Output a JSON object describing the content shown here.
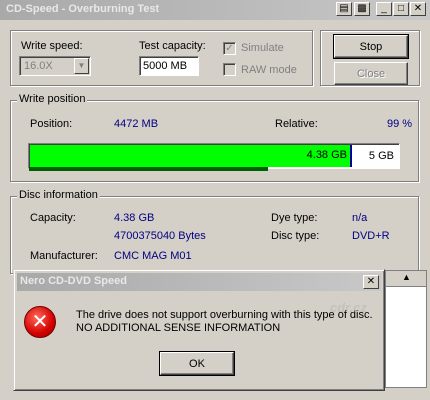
{
  "window": {
    "title": "CD-Speed - Overburning Test"
  },
  "settings": {
    "write_speed_label": "Write speed:",
    "write_speed_value": "16.0X",
    "test_capacity_label": "Test capacity:",
    "test_capacity_value": "5000 MB",
    "simulate_label": "Simulate",
    "simulate_checked": true,
    "raw_mode_label": "RAW mode",
    "raw_mode_checked": false
  },
  "buttons": {
    "stop": "Stop",
    "close": "Close"
  },
  "write_position": {
    "group_label": "Write position",
    "position_label": "Position:",
    "position_value": "4472 MB",
    "relative_label": "Relative:",
    "relative_value": "99 %",
    "progress_fraction": 0.87,
    "progress_label": "4.38 GB",
    "capacity_label": "5 GB",
    "sub_progress_fraction": 0.65
  },
  "disc_information": {
    "group_label": "Disc information",
    "capacity_label": "Capacity:",
    "capacity_value": "4.38 GB",
    "capacity_bytes": "4700375040 Bytes",
    "dye_type_label": "Dye type:",
    "dye_type_value": "n/a",
    "disc_type_label": "Disc type:",
    "disc_type_value": "DVD+R",
    "manufacturer_label": "Manufacturer:",
    "manufacturer_value": "CMC MAG M01"
  },
  "error_dialog": {
    "title": "Nero CD-DVD Speed",
    "message_line1": "The drive does not support overburning with this type of disc.",
    "message_line2": "NO ADDITIONAL SENSE INFORMATION",
    "ok_label": "OK",
    "icon": "error-icon"
  },
  "watermark": "cdr.cz",
  "colors": {
    "progress": "#00ff00",
    "value_text": "#000080",
    "error": "#d40000"
  }
}
